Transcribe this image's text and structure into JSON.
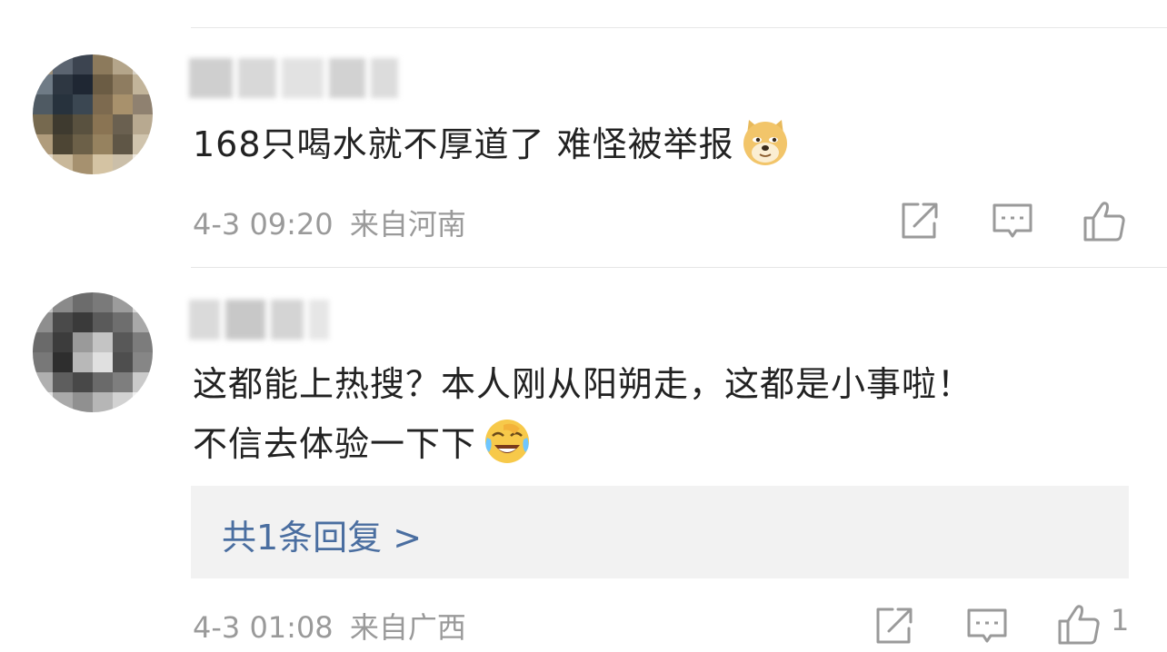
{
  "comments": [
    {
      "text_line1": "168只喝水就不厚道了 难怪被举报",
      "emoji": "doge-emoji",
      "timestamp": "4-3 09:20",
      "location": "来自河南"
    },
    {
      "text_line1": "这都能上热搜？本人刚从阳朔走，这都是小事啦！",
      "text_line2": "不信去体验一下下",
      "emoji": "laugh-cry-emoji",
      "reply_link": "共1条回复 >",
      "timestamp": "4-3 01:08",
      "location": "来自广西",
      "like_count": "1"
    }
  ],
  "icons": {
    "share": "share-icon",
    "comment": "comment-icon",
    "like": "like-icon"
  },
  "colors": {
    "link": "#4a6ea0",
    "meta": "#9a9a9a",
    "text": "#222222",
    "reply_bg": "#f2f2f2"
  }
}
